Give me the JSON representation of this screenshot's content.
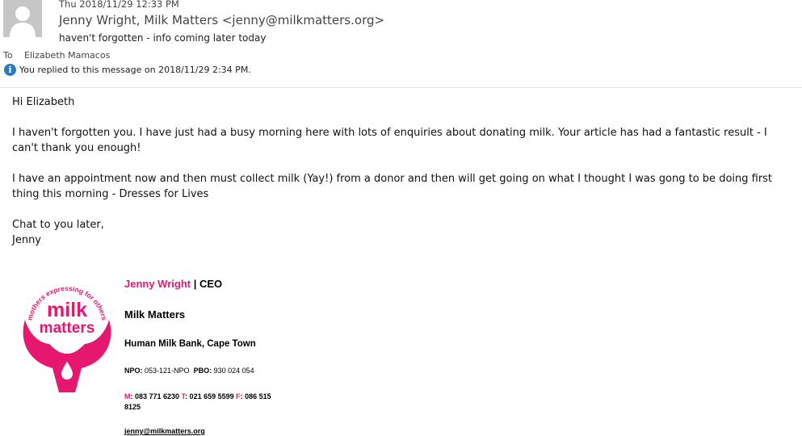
{
  "header": {
    "date": "Thu 2018/11/29 12:33 PM",
    "from": "Jenny Wright, Milk Matters <jenny@milkmatters.org>",
    "subject": "haven't forgotten - info coming later today",
    "to_label": "To",
    "to_name": "Elizabeth Mamacos",
    "info": "You replied to this message on 2018/11/29 2:34 PM."
  },
  "body": {
    "greeting": "Hi Elizabeth",
    "para1": "I haven't forgotten you. I have just had a busy morning here with lots of enquiries about donating milk. Your article has had a fantastic result - I can't thank you enough!",
    "para2": "I have an appointment now and then must collect milk (Yay!) from a donor and then will get going on what I thought I was gong to be doing first thing this morning - Dresses for Lives",
    "closing1": "Chat to you later,",
    "closing2": "Jenny"
  },
  "signature": {
    "name": "Jenny Wright",
    "sep": " | ",
    "title": "CEO",
    "org": "Milk Matters",
    "address": "Human Milk Bank, Cape Town",
    "npo_label": "NPO:",
    "npo_value": "053-121-NPO",
    "pbo_label": "PBO:",
    "pbo_value": "930 024 054",
    "m_label": "M",
    "m_value": ": 083 771 6230 ",
    "t_label": "T",
    "t_value": ": 021 659 5599  ",
    "f_label": "F",
    "f_value": ": 086 515",
    "f_value2": "8125",
    "email": "jenny@milkmatters.org",
    "logo_tagline": "mothers expressing for others",
    "logo_word1": "milk",
    "logo_word2": "matters"
  },
  "colors": {
    "brand": "#e6176f",
    "info_icon": "#2b79c2"
  }
}
